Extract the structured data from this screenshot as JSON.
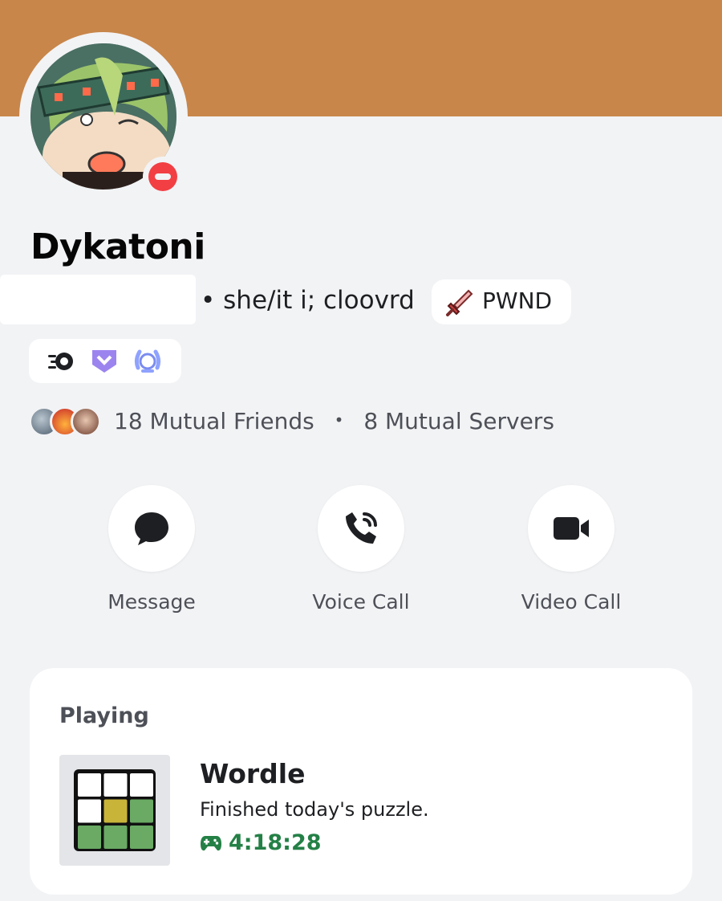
{
  "profile": {
    "banner_color": "#c8864a",
    "display_name": "Dykatoni",
    "status": "do-not-disturb",
    "status_color": "#f23f43",
    "pronouns_text": "• she/it i; cloovrd",
    "guild_tag": {
      "icon": "sword-icon",
      "text": "PWND"
    },
    "badges": [
      "nitro-badge-icon",
      "hypesquad-badge-icon",
      "quest-laurel-badge-icon"
    ]
  },
  "mutuals": {
    "friends_text": "18 Mutual Friends",
    "separator": "•",
    "servers_text": "8 Mutual Servers"
  },
  "actions": [
    {
      "label": "Message",
      "icon": "message-bubble-icon"
    },
    {
      "label": "Voice Call",
      "icon": "phone-call-icon"
    },
    {
      "label": "Video Call",
      "icon": "video-camera-icon"
    }
  ],
  "activity": {
    "header": "Playing",
    "game_name": "Wordle",
    "details": "Finished today's puzzle.",
    "elapsed": "4:18:28",
    "elapsed_color": "#248046",
    "grid_rows": [
      [
        "empty",
        "empty",
        "empty"
      ],
      [
        "empty",
        "yellow",
        "green"
      ],
      [
        "green",
        "green",
        "green"
      ]
    ]
  }
}
